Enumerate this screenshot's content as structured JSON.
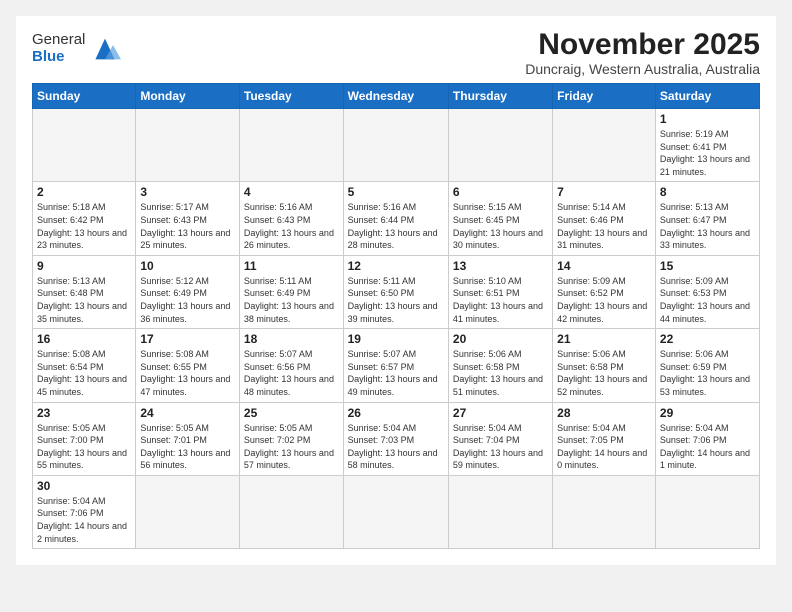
{
  "header": {
    "logo_general": "General",
    "logo_blue": "Blue",
    "month": "November 2025",
    "location": "Duncraig, Western Australia, Australia"
  },
  "weekdays": [
    "Sunday",
    "Monday",
    "Tuesday",
    "Wednesday",
    "Thursday",
    "Friday",
    "Saturday"
  ],
  "days": {
    "1": {
      "sunrise": "5:19 AM",
      "sunset": "6:41 PM",
      "daylight": "13 hours and 21 minutes."
    },
    "2": {
      "sunrise": "5:18 AM",
      "sunset": "6:42 PM",
      "daylight": "13 hours and 23 minutes."
    },
    "3": {
      "sunrise": "5:17 AM",
      "sunset": "6:43 PM",
      "daylight": "13 hours and 25 minutes."
    },
    "4": {
      "sunrise": "5:16 AM",
      "sunset": "6:43 PM",
      "daylight": "13 hours and 26 minutes."
    },
    "5": {
      "sunrise": "5:16 AM",
      "sunset": "6:44 PM",
      "daylight": "13 hours and 28 minutes."
    },
    "6": {
      "sunrise": "5:15 AM",
      "sunset": "6:45 PM",
      "daylight": "13 hours and 30 minutes."
    },
    "7": {
      "sunrise": "5:14 AM",
      "sunset": "6:46 PM",
      "daylight": "13 hours and 31 minutes."
    },
    "8": {
      "sunrise": "5:13 AM",
      "sunset": "6:47 PM",
      "daylight": "13 hours and 33 minutes."
    },
    "9": {
      "sunrise": "5:13 AM",
      "sunset": "6:48 PM",
      "daylight": "13 hours and 35 minutes."
    },
    "10": {
      "sunrise": "5:12 AM",
      "sunset": "6:49 PM",
      "daylight": "13 hours and 36 minutes."
    },
    "11": {
      "sunrise": "5:11 AM",
      "sunset": "6:49 PM",
      "daylight": "13 hours and 38 minutes."
    },
    "12": {
      "sunrise": "5:11 AM",
      "sunset": "6:50 PM",
      "daylight": "13 hours and 39 minutes."
    },
    "13": {
      "sunrise": "5:10 AM",
      "sunset": "6:51 PM",
      "daylight": "13 hours and 41 minutes."
    },
    "14": {
      "sunrise": "5:09 AM",
      "sunset": "6:52 PM",
      "daylight": "13 hours and 42 minutes."
    },
    "15": {
      "sunrise": "5:09 AM",
      "sunset": "6:53 PM",
      "daylight": "13 hours and 44 minutes."
    },
    "16": {
      "sunrise": "5:08 AM",
      "sunset": "6:54 PM",
      "daylight": "13 hours and 45 minutes."
    },
    "17": {
      "sunrise": "5:08 AM",
      "sunset": "6:55 PM",
      "daylight": "13 hours and 47 minutes."
    },
    "18": {
      "sunrise": "5:07 AM",
      "sunset": "6:56 PM",
      "daylight": "13 hours and 48 minutes."
    },
    "19": {
      "sunrise": "5:07 AM",
      "sunset": "6:57 PM",
      "daylight": "13 hours and 49 minutes."
    },
    "20": {
      "sunrise": "5:06 AM",
      "sunset": "6:58 PM",
      "daylight": "13 hours and 51 minutes."
    },
    "21": {
      "sunrise": "5:06 AM",
      "sunset": "6:58 PM",
      "daylight": "13 hours and 52 minutes."
    },
    "22": {
      "sunrise": "5:06 AM",
      "sunset": "6:59 PM",
      "daylight": "13 hours and 53 minutes."
    },
    "23": {
      "sunrise": "5:05 AM",
      "sunset": "7:00 PM",
      "daylight": "13 hours and 55 minutes."
    },
    "24": {
      "sunrise": "5:05 AM",
      "sunset": "7:01 PM",
      "daylight": "13 hours and 56 minutes."
    },
    "25": {
      "sunrise": "5:05 AM",
      "sunset": "7:02 PM",
      "daylight": "13 hours and 57 minutes."
    },
    "26": {
      "sunrise": "5:04 AM",
      "sunset": "7:03 PM",
      "daylight": "13 hours and 58 minutes."
    },
    "27": {
      "sunrise": "5:04 AM",
      "sunset": "7:04 PM",
      "daylight": "13 hours and 59 minutes."
    },
    "28": {
      "sunrise": "5:04 AM",
      "sunset": "7:05 PM",
      "daylight": "14 hours and 0 minutes."
    },
    "29": {
      "sunrise": "5:04 AM",
      "sunset": "7:06 PM",
      "daylight": "14 hours and 1 minute."
    },
    "30": {
      "sunrise": "5:04 AM",
      "sunset": "7:06 PM",
      "daylight": "14 hours and 2 minutes."
    }
  }
}
